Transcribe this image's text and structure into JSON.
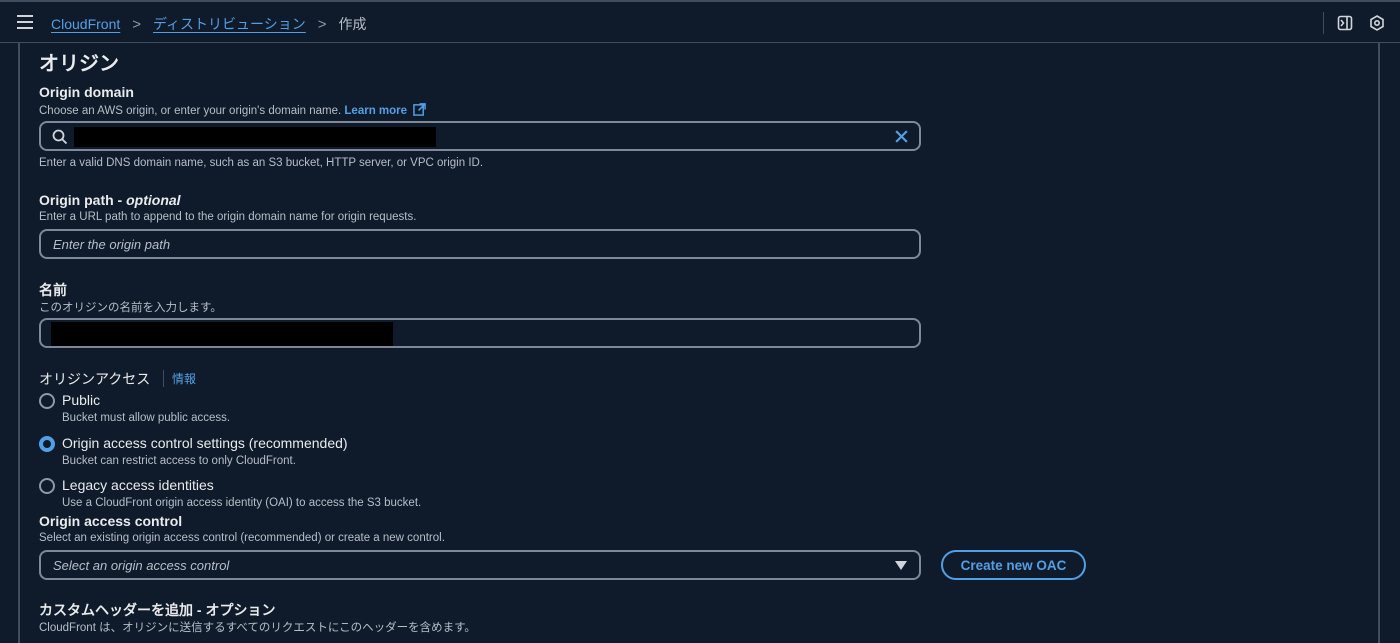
{
  "breadcrumb": {
    "items": [
      "CloudFront",
      "ディストリビューション"
    ],
    "current": "作成",
    "separator": ">"
  },
  "section": {
    "title": "オリジン"
  },
  "origin_domain": {
    "label": "Origin domain",
    "description": "Choose an AWS origin, or enter your origin's domain name.",
    "learn_more": "Learn more",
    "hint": "Enter a valid DNS domain name, such as an S3 bucket, HTTP server, or VPC origin ID."
  },
  "origin_path": {
    "label_main": "Origin path - ",
    "label_optional": "optional",
    "description": "Enter a URL path to append to the origin domain name for origin requests.",
    "placeholder": "Enter the origin path"
  },
  "name_field": {
    "label": "名前",
    "description": "このオリジンの名前を入力します。"
  },
  "origin_access": {
    "label": "オリジンアクセス",
    "info": "情報",
    "options": [
      {
        "label": "Public",
        "description": "Bucket must allow public access.",
        "selected": false
      },
      {
        "label": "Origin access control settings (recommended)",
        "description": "Bucket can restrict access to only CloudFront.",
        "selected": true
      },
      {
        "label": "Legacy access identities",
        "description": "Use a CloudFront origin access identity (OAI) to access the S3 bucket.",
        "selected": false
      }
    ]
  },
  "oac": {
    "label": "Origin access control",
    "description": "Select an existing origin access control (recommended) or create a new control.",
    "placeholder": "Select an origin access control",
    "create_button": "Create new OAC"
  },
  "custom_headers": {
    "label": "カスタムヘッダーを追加 - オプション",
    "description": "CloudFront は、オリジンに送信するすべてのリクエストにこのヘッダーを含めます。"
  },
  "colors": {
    "accent": "#539fe5",
    "background": "#0f1b2a",
    "border": "#7d8998"
  }
}
